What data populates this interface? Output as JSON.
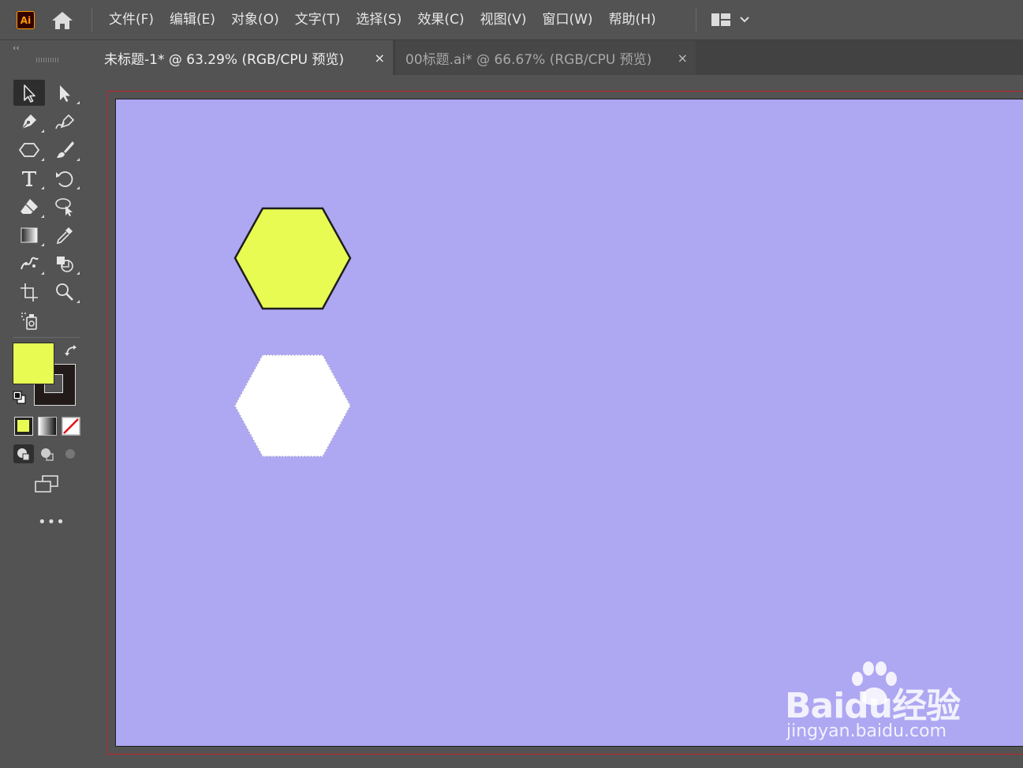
{
  "app": {
    "logo_text": "Ai",
    "accent": "#ff9a00"
  },
  "menu": {
    "items": [
      "文件(F)",
      "编辑(E)",
      "对象(O)",
      "文字(T)",
      "选择(S)",
      "效果(C)",
      "视图(V)",
      "窗口(W)",
      "帮助(H)"
    ]
  },
  "tabs": [
    {
      "title": "未标题-1* @ 63.29% (RGB/CPU 预览)",
      "close": "×",
      "active": true
    },
    {
      "title": "00标题.ai* @ 66.67% (RGB/CPU 预览)",
      "close": "×",
      "active": false
    }
  ],
  "toolbar": {
    "collapse_label": "‹‹",
    "tools": [
      "selection-tool",
      "direct-selection-tool",
      "pen-tool",
      "curvature-tool",
      "polygon-tool",
      "paintbrush-tool",
      "type-tool",
      "rotate-tool",
      "eraser-tool",
      "lasso-select-tool",
      "gradient-tool",
      "eyedropper-tool",
      "puppet-warp-tool",
      "shape-builder-tool",
      "artboard-tool",
      "zoom-tool",
      "symbol-sprayer-tool"
    ],
    "fill_color": "#e8fb52",
    "stroke_color": "#231a1a",
    "more_label": "•••"
  },
  "canvas": {
    "artboard_color": "#aea7f2",
    "hexagon_top_fill": "#e8fb52",
    "hexagon_top_stroke": "#1e1e1e",
    "hexagon_bottom_fill": "#ffffff"
  },
  "watermark": {
    "brand": "Baidu经验",
    "url": "jingyan.baidu.com"
  }
}
